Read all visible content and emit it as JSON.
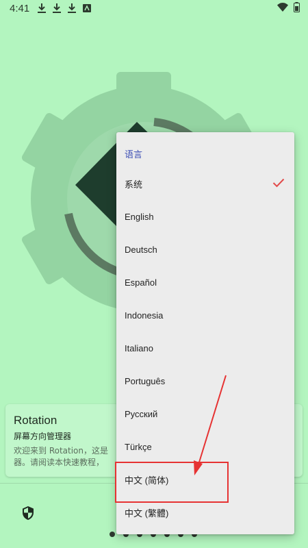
{
  "status_bar": {
    "time": "4:41",
    "left_icons": [
      "download-icon",
      "download-icon",
      "download-icon",
      "app-icon"
    ],
    "right_icons": [
      "wifi-icon",
      "battery-icon"
    ]
  },
  "intro_card": {
    "title": "Rotation",
    "subtitle": "屏幕方向管理器",
    "description": "欢迎来到 Rotation，这是 器。请阅读本快速教程，"
  },
  "language_menu": {
    "header": "语言",
    "items": [
      {
        "label": "系统",
        "selected": true
      },
      {
        "label": "English"
      },
      {
        "label": "Deutsch"
      },
      {
        "label": "Español"
      },
      {
        "label": "Indonesia"
      },
      {
        "label": "Italiano"
      },
      {
        "label": "Português"
      },
      {
        "label": "Русский"
      },
      {
        "label": "Türkçe"
      },
      {
        "label": "中文 (简体)"
      },
      {
        "label": "中文 (繁體)"
      }
    ]
  },
  "page_indicator": {
    "total": 7,
    "current": 1
  },
  "colors": {
    "background": "#b3f5bf",
    "gear": "#94d4a2",
    "menu_header": "#3f51b5",
    "check": "#e24a4a",
    "annotation": "#e63232"
  }
}
